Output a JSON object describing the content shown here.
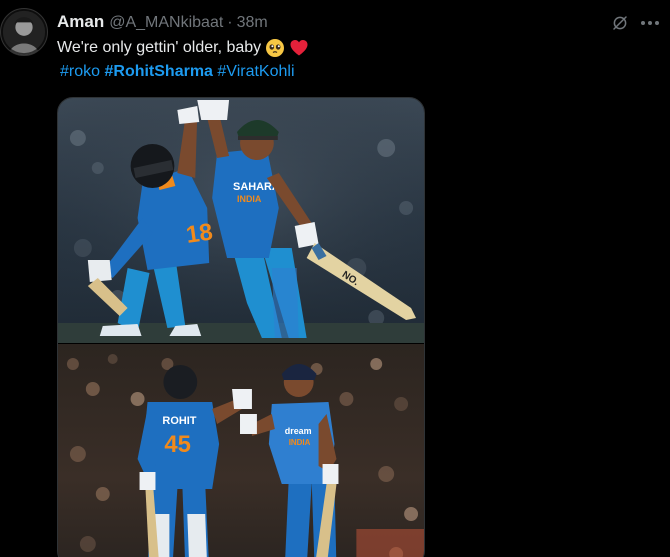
{
  "author": {
    "display_name": "Aman",
    "handle": "@A_MANkibaat",
    "separator": "·",
    "timestamp": "38m"
  },
  "tweet": {
    "text": "We're only gettin' older, baby",
    "emojis": [
      "pleading-face-emoji",
      "red-heart-emoji"
    ],
    "hashtags": [
      {
        "label": "#roko",
        "bold": false
      },
      {
        "label": "#RohitSharma",
        "bold": true
      },
      {
        "label": "#ViratKohli",
        "bold": false
      }
    ]
  },
  "media": {
    "top_photo": {
      "jersey_texts": [
        "SAHARA",
        "INDIA",
        "18"
      ],
      "bat_text": "NO."
    },
    "bottom_photo": {
      "jersey_texts": [
        "ROHIT",
        "45",
        "dream",
        "INDIA"
      ]
    }
  },
  "colors": {
    "background": "#000000",
    "text_primary": "#e7e9ea",
    "text_secondary": "#71767b",
    "link": "#1d9bf0",
    "jersey_blue": "#1e6fc0"
  }
}
